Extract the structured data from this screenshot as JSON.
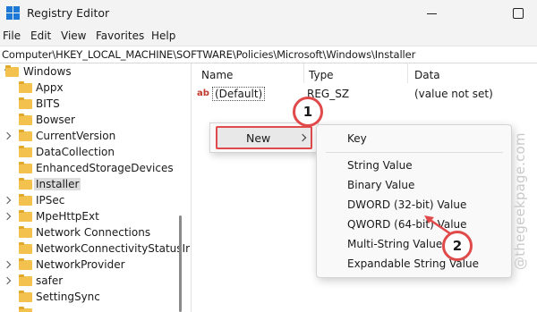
{
  "window": {
    "title": "Registry Editor"
  },
  "menubar": {
    "items": [
      "File",
      "Edit",
      "View",
      "Favorites",
      "Help"
    ]
  },
  "address": {
    "path": "Computer\\HKEY_LOCAL_MACHINE\\SOFTWARE\\Policies\\Microsoft\\Windows\\Installer"
  },
  "tree": {
    "root": {
      "label": "Windows",
      "expanded": true
    },
    "children": [
      {
        "label": "Appx",
        "has_children": false,
        "selected": false
      },
      {
        "label": "BITS",
        "has_children": false,
        "selected": false
      },
      {
        "label": "Bowser",
        "has_children": false,
        "selected": false
      },
      {
        "label": "CurrentVersion",
        "has_children": true,
        "selected": false
      },
      {
        "label": "DataCollection",
        "has_children": false,
        "selected": false
      },
      {
        "label": "EnhancedStorageDevices",
        "has_children": false,
        "selected": false
      },
      {
        "label": "Installer",
        "has_children": false,
        "selected": true
      },
      {
        "label": "IPSec",
        "has_children": true,
        "selected": false
      },
      {
        "label": "MpeHttpExt",
        "has_children": true,
        "selected": false
      },
      {
        "label": "Network Connections",
        "has_children": false,
        "selected": false
      },
      {
        "label": "NetworkConnectivityStatusIr",
        "has_children": false,
        "selected": false
      },
      {
        "label": "NetworkProvider",
        "has_children": true,
        "selected": false
      },
      {
        "label": "safer",
        "has_children": true,
        "selected": false
      },
      {
        "label": "SettingSync",
        "has_children": false,
        "selected": false
      }
    ]
  },
  "values_pane": {
    "headers": {
      "name": "Name",
      "type": "Type",
      "data": "Data"
    },
    "rows": [
      {
        "icon": "ab",
        "name": "(Default)",
        "type": "REG_SZ",
        "data": "(value not set)"
      }
    ]
  },
  "context_menu": {
    "new_label": "New"
  },
  "submenu": {
    "items": [
      "Key",
      "String Value",
      "Binary Value",
      "DWORD (32-bit) Value",
      "QWORD (64-bit) Value",
      "Multi-String Value",
      "Expandable String Value"
    ]
  },
  "callouts": {
    "step1": "1",
    "step2": "2"
  },
  "watermark": {
    "text": "@thegeekpage.com"
  },
  "colors": {
    "accent_red": "#e04a4a",
    "folder_yellow": "#f2c14e",
    "selection_gray": "#dcdcdc"
  }
}
